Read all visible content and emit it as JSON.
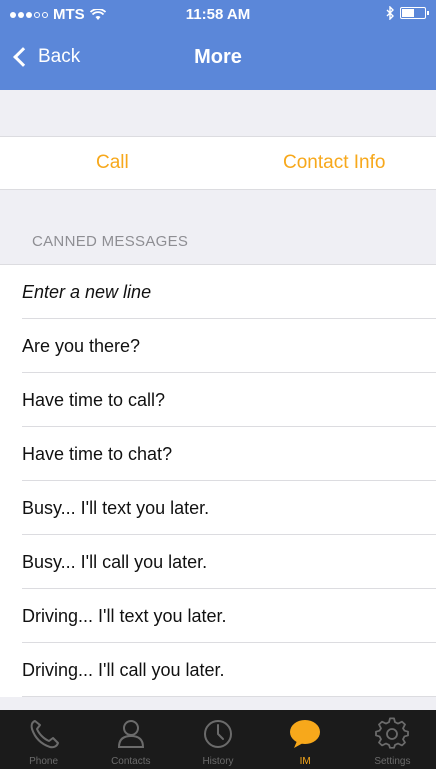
{
  "status_bar": {
    "carrier": "MTS",
    "time": "11:58 AM"
  },
  "nav": {
    "back_label": "Back",
    "title": "More"
  },
  "actions": {
    "call_label": "Call",
    "contact_info_label": "Contact Info"
  },
  "canned_section": {
    "header": "CANNED MESSAGES",
    "items": [
      "Enter a new line",
      "Are you there?",
      "Have time to call?",
      "Have time to chat?",
      "Busy... I'll text you later.",
      "Busy... I'll call you later.",
      "Driving... I'll text you later.",
      "Driving... I'll call you later."
    ]
  },
  "tab_bar": {
    "tabs": [
      {
        "label": "Phone",
        "icon": "phone-icon"
      },
      {
        "label": "Contacts",
        "icon": "contacts-icon"
      },
      {
        "label": "History",
        "icon": "clock-icon"
      },
      {
        "label": "IM",
        "icon": "chat-bubble-icon",
        "active": true
      },
      {
        "label": "Settings",
        "icon": "gear-icon"
      }
    ]
  },
  "colors": {
    "nav_bg": "#5b87d9",
    "accent": "#f7a81b",
    "tab_bar_bg": "#1b1b1b",
    "page_bg": "#efeff4"
  }
}
